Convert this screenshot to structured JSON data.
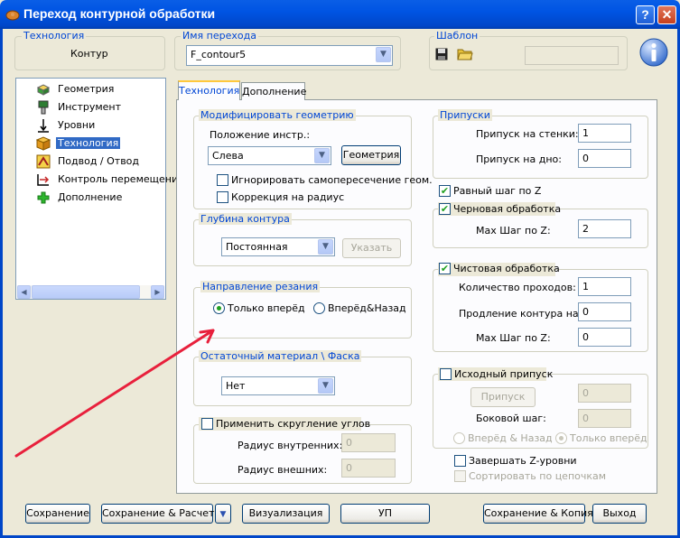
{
  "window": {
    "title": "Переход контурной обработки",
    "help_btn": "?",
    "close_btn": "✕"
  },
  "technology_box": {
    "label": "Технология",
    "value": "Контур"
  },
  "op_name_box": {
    "label": "Имя перехода",
    "value": "F_contour5"
  },
  "template_box": {
    "label": "Шаблон",
    "value": ""
  },
  "tree": {
    "items": [
      {
        "label": "Геометрия",
        "icon": "geometry-icon"
      },
      {
        "label": "Инструмент",
        "icon": "tool-icon"
      },
      {
        "label": "Уровни",
        "icon": "levels-icon"
      },
      {
        "label": "Технология",
        "icon": "technology-icon",
        "selected": true
      },
      {
        "label": "Подвод / Отвод",
        "icon": "approach-icon"
      },
      {
        "label": "Контроль перемещений",
        "icon": "motion-control-icon"
      },
      {
        "label": "Дополнение",
        "icon": "plus-icon"
      }
    ]
  },
  "tabs": [
    {
      "label": "Технология",
      "active": true
    },
    {
      "label": "Дополнение",
      "active": false
    }
  ],
  "modify_geom": {
    "label": "Модифицировать геометрию",
    "position_label": "Положение инстр.:",
    "position_value": "Слева",
    "geometry_btn": "Геометрия",
    "ignore_self_intersect": "Игнорировать самопересечение геом.",
    "radius_correction": "Коррекция на радиус"
  },
  "contour_depth": {
    "label": "Глубина контура",
    "value": "Постоянная",
    "specify_btn": "Указать"
  },
  "cut_direction": {
    "label": "Направление резания",
    "forward_only": "Только вперёд",
    "forward_back": "Вперёд&Назад"
  },
  "residual": {
    "label": "Остаточный материал \\ Фаска",
    "value": "Нет"
  },
  "corner_round": {
    "label": "Применить скругление углов",
    "inner_label": "Радиус внутренних:",
    "inner_value": "0",
    "outer_label": "Радиус внешних:",
    "outer_value": "0"
  },
  "allowances": {
    "label": "Припуски",
    "wall_label": "Припуск на стенки:",
    "wall_value": "1",
    "floor_label": "Припуск на дно:",
    "floor_value": "0"
  },
  "equal_z_step": "Равный шаг по Z",
  "rough": {
    "label": "Черновая обработка",
    "max_z_label": "Max Шаг по Z:",
    "max_z_value": "2"
  },
  "finish": {
    "label": "Чистовая обработка",
    "passes_label": "Количество проходов:",
    "passes_value": "1",
    "extend_label": "Продление контура на:",
    "extend_value": "0",
    "max_z_label": "Max Шаг по Z:",
    "max_z_value": "0"
  },
  "stock": {
    "label": "Исходный припуск",
    "allowance_btn": "Припуск",
    "allowance_value": "0",
    "side_step_label": "Боковой шаг:",
    "side_step_value": "0",
    "forward_back": "Вперёд & Назад",
    "forward_only": "Только вперёд"
  },
  "finish_z_levels": "Завершать Z-уровни",
  "sort_by_chains": "Сортировать по цепочкам",
  "footer": {
    "save": "Сохранение",
    "save_calc": "Сохранение & Расчет",
    "visualize": "Визуализация",
    "up": "УП",
    "save_copy": "Сохранение & Копия",
    "exit": "Выход"
  },
  "colors": {
    "accent": "#0046d5",
    "titlebar": "#0054e3",
    "annotation_arrow": "#e8203c"
  }
}
